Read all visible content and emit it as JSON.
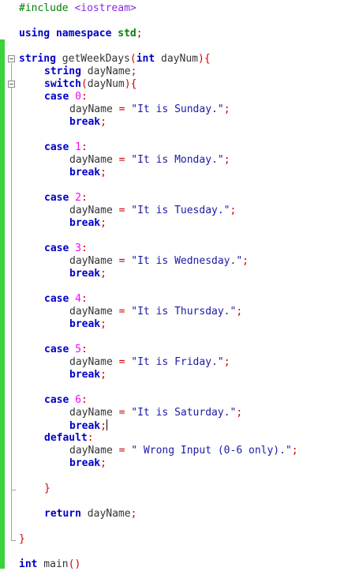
{
  "editor": {
    "lines": {
      "l1": {
        "pp": "#include ",
        "inc": "<iostream>"
      },
      "l2": {
        "kw1": "using",
        "kw2": "namespace",
        "std": "std",
        "semi": ";"
      },
      "l3": {
        "type": "string",
        "name": " getWeekDays",
        "lp": "(",
        "type2": "int",
        "param": " dayNum",
        "rp": ")",
        "brace": "{"
      },
      "l4": {
        "type": "string",
        "name": " dayName",
        "semi": ";"
      },
      "l5": {
        "kw": "switch",
        "lp": "(",
        "arg": "dayNum",
        "rp": ")",
        "brace": "{"
      },
      "cases": [
        {
          "label": "case",
          "num": " 0",
          "colon": ":",
          "lhs": "dayName",
          "eq": " = ",
          "str": "\"It is Sunday.\"",
          "semi": ";",
          "brk": "break",
          "brkSemi": ";"
        },
        {
          "label": "case",
          "num": " 1",
          "colon": ":",
          "lhs": "dayName",
          "eq": " = ",
          "str": "\"It is Monday.\"",
          "semi": ";",
          "brk": "break",
          "brkSemi": ";"
        },
        {
          "label": "case",
          "num": " 2",
          "colon": ":",
          "lhs": "dayName",
          "eq": " = ",
          "str": "\"It is Tuesday.\"",
          "semi": ";",
          "brk": "break",
          "brkSemi": ";"
        },
        {
          "label": "case",
          "num": " 3",
          "colon": ":",
          "lhs": "dayName",
          "eq": " = ",
          "str": "\"It is Wednesday.\"",
          "semi": ";",
          "brk": "break",
          "brkSemi": ";"
        },
        {
          "label": "case",
          "num": " 4",
          "colon": ":",
          "lhs": "dayName",
          "eq": " = ",
          "str": "\"It is Thursday.\"",
          "semi": ";",
          "brk": "break",
          "brkSemi": ";"
        },
        {
          "label": "case",
          "num": " 5",
          "colon": ":",
          "lhs": "dayName",
          "eq": " = ",
          "str": "\"It is Friday.\"",
          "semi": ";",
          "brk": "break",
          "brkSemi": ";"
        },
        {
          "label": "case",
          "num": " 6",
          "colon": ":",
          "lhs": "dayName",
          "eq": " = ",
          "str": "\"It is Saturday.\"",
          "semi": ";",
          "brk": "break",
          "brkSemi": ";"
        }
      ],
      "default": {
        "label": "default",
        "colon": ":",
        "lhs": "dayName",
        "eq": " = ",
        "str": "\" Wrong Input (0-6 only).\"",
        "semi": ";",
        "brk": "break",
        "brkSemi": ";"
      },
      "switchClose": "}",
      "ret": {
        "kw": "return",
        "val": " dayName",
        "semi": ";"
      },
      "funcClose": "}",
      "main": {
        "type": "int",
        "name": " main",
        "parens": "()"
      }
    },
    "colors": {
      "keyword": "#0000c8",
      "string": "#1a1aa6",
      "number": "#ff00ff",
      "operator": "#cc0000",
      "preprocessor": "#008000",
      "change_bar": "#3bd23b"
    }
  }
}
